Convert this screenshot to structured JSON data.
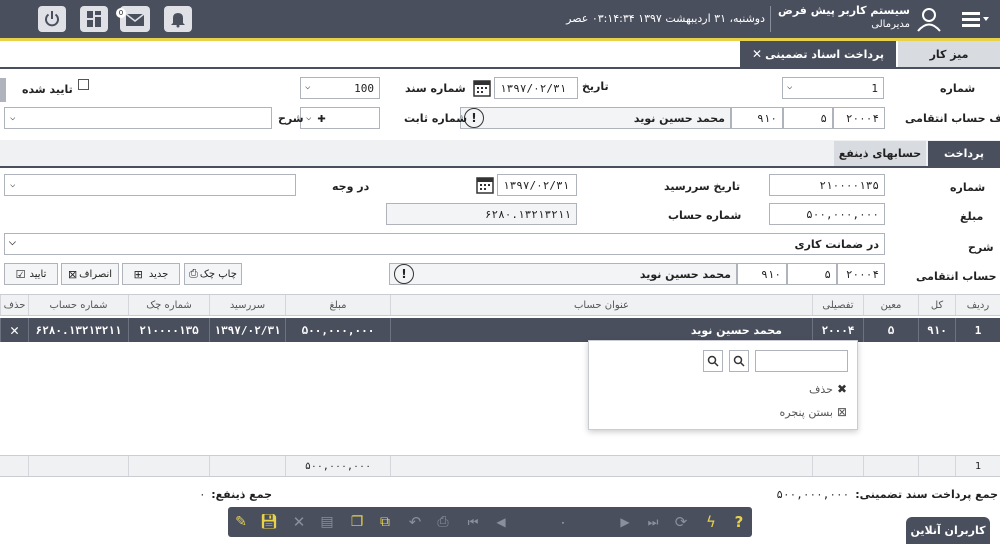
{
  "header": {
    "system_name": "سیستم کاربر پیش فرض",
    "user_role": "مدیرمالی",
    "datetime": "دوشنبه، ۳۱ اردیبهشت ۱۳۹۷  ۰۳:۱۴:۳۴ عصر",
    "mail_badge": "0"
  },
  "tabs": {
    "desk": "میز کار",
    "payment_guarantee": "پرداخت اسناد تضمینی"
  },
  "form": {
    "number_label": "شماره",
    "number_value": "1",
    "date_label": "تاریخ",
    "date_value": "۱۳۹۷/۰۲/۳۱",
    "doc_number_label": "شماره سند",
    "doc_number_value": "100",
    "approved_label": "تایید شده",
    "counterparty_label": "طرف حساب انتقامی",
    "cp_code1": "۲۰۰۰۴",
    "cp_code2": "۵",
    "cp_code3": "۹۱۰",
    "cp_name": "محمد حسین نوید",
    "fixed_number_label": "شماره ثابت",
    "description_label": "شرح"
  },
  "subtabs": {
    "payment": "پرداخت",
    "beneficiary_accounts": "حسابهای ذینفع"
  },
  "detail": {
    "number_label": "شماره",
    "number_value": "۲۱۰۰۰۰۱۳۵",
    "due_date_label": "تاریخ سررسید",
    "due_date_value": "۱۳۹۷/۰۲/۳۱",
    "in_favor_label": "در وجه",
    "amount_label": "مبلغ",
    "amount_value": "۵۰۰,۰۰۰,۰۰۰",
    "account_number_label": "شماره حساب",
    "account_number_value": "۶۲۸۰.۱۳۲۱۳۲۱۱",
    "description_label": "شرح",
    "description_value": "در ضمانت کاری",
    "transfer_label": "حساب انتقامی",
    "tr_code1": "۲۰۰۰۴",
    "tr_code2": "۵",
    "tr_code3": "۹۱۰",
    "tr_name": "محمد حسین نوید"
  },
  "actions": {
    "print_check": "چاپ چک",
    "new": "جدید",
    "cancel": "انصراف",
    "confirm": "تایید"
  },
  "table": {
    "headers": [
      "ردیف",
      "کل",
      "معین",
      "تفصیلی",
      "عنوان حساب",
      "مبلغ",
      "سررسید",
      "شماره چک",
      "شماره حساب",
      "حذف"
    ],
    "row": [
      "1",
      "۹۱۰",
      "۵",
      "۲۰۰۰۴",
      "محمد حسین نوید",
      "۵۰۰,۰۰۰,۰۰۰",
      "۱۳۹۷/۰۲/۳۱",
      "۲۱۰۰۰۰۱۳۵",
      "۶۲۸۰.۱۳۲۱۳۲۱۱"
    ],
    "footer_count": "1",
    "footer_sum": "۵۰۰,۰۰۰,۰۰۰"
  },
  "popup": {
    "delete": "حذف",
    "close_window": "بستن پنجره"
  },
  "summary": {
    "total_guarantee_label": "جمع پرداخت سند تضمینی:",
    "total_guarantee_value": "۵۰۰,۰۰۰,۰۰۰",
    "total_beneficiary_label": "جمع ذینفع:",
    "total_beneficiary_value": "۰"
  },
  "toolbar": {
    "center_value": "۰"
  },
  "online_users": "کاربران آنلاین",
  "colors": {
    "header_bg": "#4a4f5e",
    "accent": "#e8d24a"
  }
}
